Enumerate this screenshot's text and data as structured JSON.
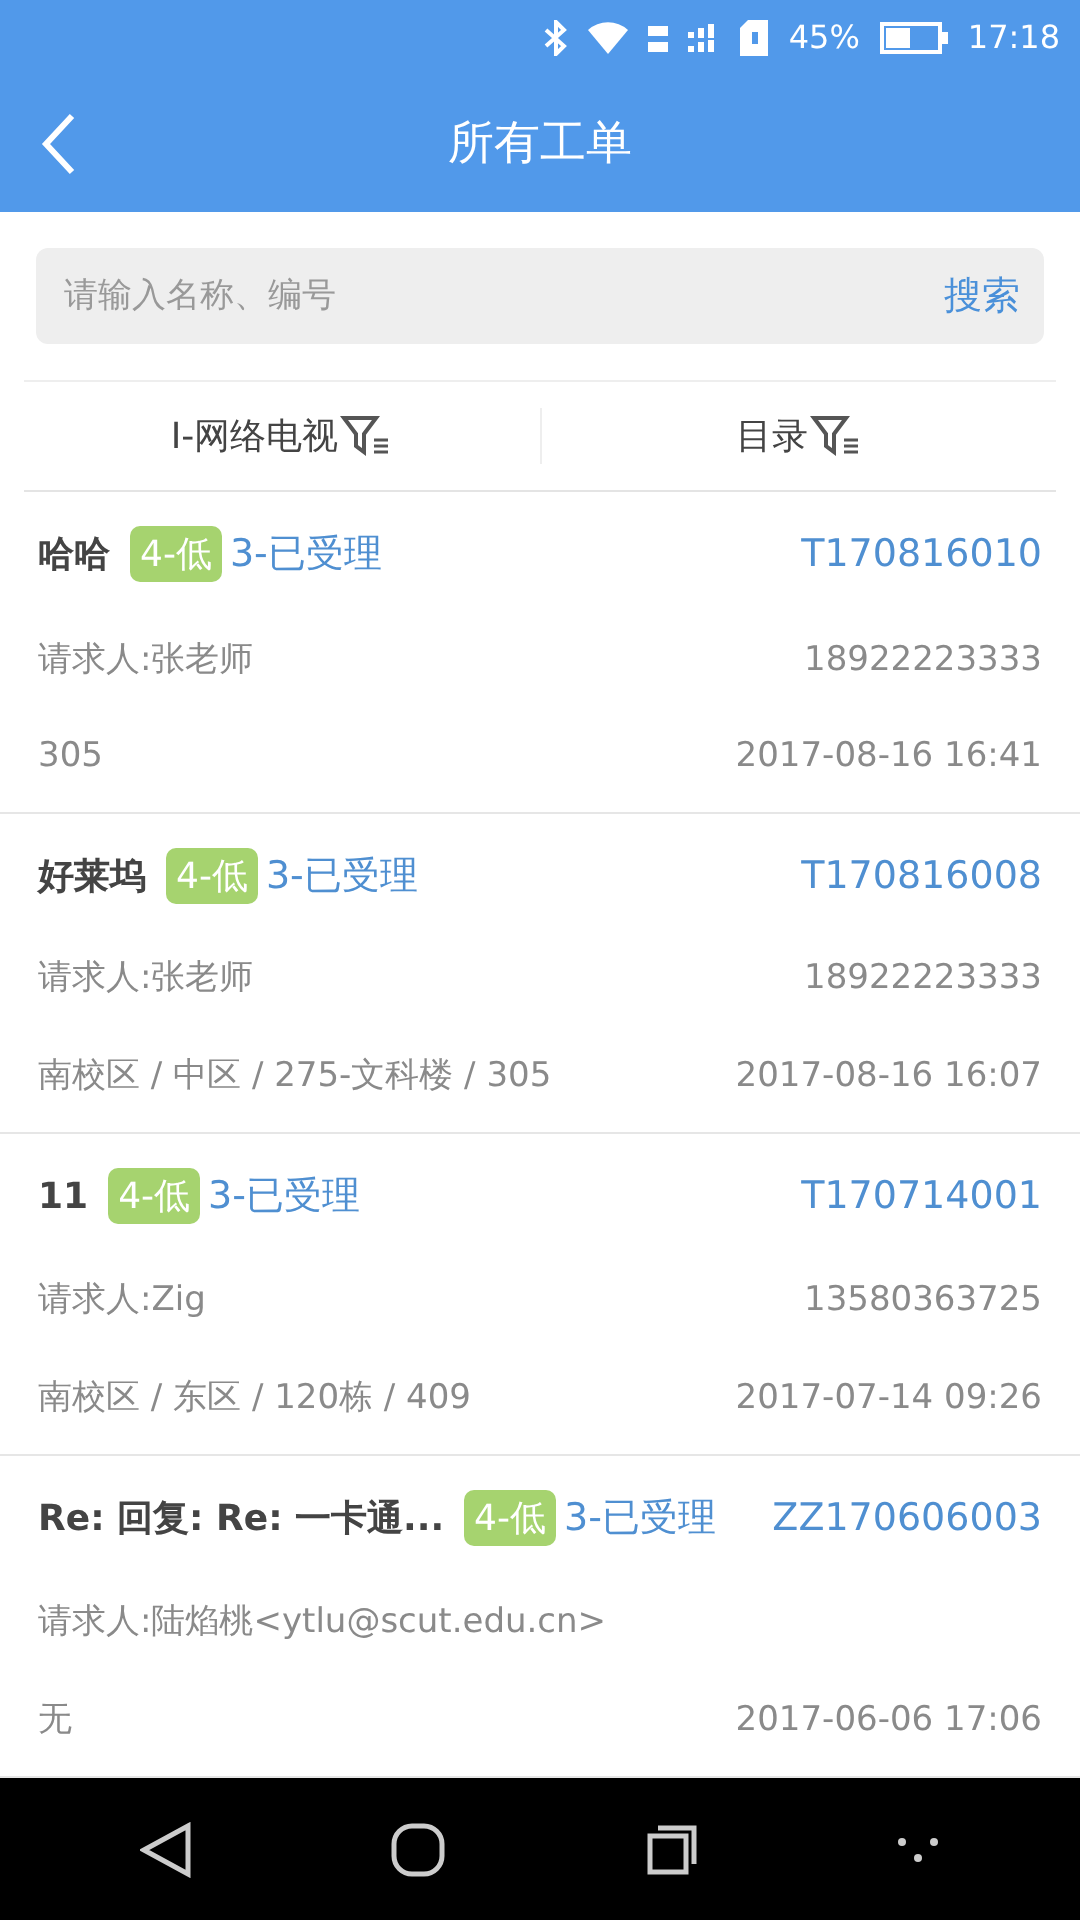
{
  "status_bar": {
    "battery_text": "45%",
    "time": "17:18"
  },
  "header": {
    "title": "所有工单"
  },
  "search": {
    "placeholder": "请输入名称、编号",
    "button": "搜索"
  },
  "filters": [
    {
      "label": "I-网络电视"
    },
    {
      "label": "目录"
    }
  ],
  "orders": [
    {
      "title": "哈哈",
      "priority": "4-低",
      "status": "3-已受理",
      "id": "T170816010",
      "requester": "请求人:张老师",
      "phone": "18922223333",
      "location": "305",
      "time": "2017-08-16 16:41"
    },
    {
      "title": "好莱坞",
      "priority": "4-低",
      "status": "3-已受理",
      "id": "T170816008",
      "requester": "请求人:张老师",
      "phone": "18922223333",
      "location": "南校区 / 中区 / 275-文科楼 / 305",
      "time": "2017-08-16 16:07"
    },
    {
      "title": "11",
      "priority": "4-低",
      "status": "3-已受理",
      "id": "T170714001",
      "requester": "请求人:Zig",
      "phone": "13580363725",
      "location": "南校区 / 东区 / 120栋 / 409",
      "time": "2017-07-14 09:26"
    },
    {
      "title": "Re: 回复: Re: 一卡通...",
      "priority": "4-低",
      "status": "3-已受理",
      "id": "ZZ170606003",
      "requester": "请求人:陆焰桃<ytlu@scut.edu.cn>",
      "location": "无",
      "time": "2017-06-06 17:06"
    }
  ]
}
